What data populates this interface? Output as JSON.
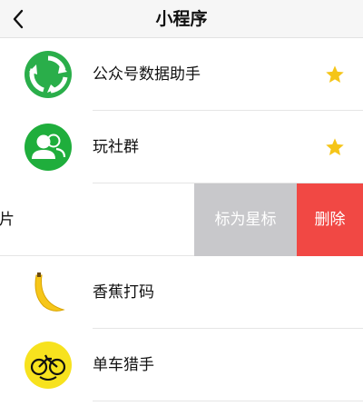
{
  "nav": {
    "title": "小程序",
    "back_icon": "chevron-left-icon"
  },
  "rows": [
    {
      "label": "公众号数据助手",
      "icon": "recycle-arrows-icon",
      "starred": true
    },
    {
      "label": "玩社群",
      "icon": "people-icon",
      "starred": true
    },
    {
      "label": "卡片",
      "swiped": true,
      "actions": {
        "mark_star": "标为星标",
        "delete": "删除"
      }
    },
    {
      "label": "香蕉打码",
      "icon": "banana-icon",
      "starred": false
    },
    {
      "label": "单车猎手",
      "icon": "bicycle-face-icon",
      "starred": false
    }
  ],
  "colors": {
    "star": "#f5c518",
    "green": "#2aae4a",
    "delete": "#f14844",
    "mark": "#c8c8cb"
  }
}
